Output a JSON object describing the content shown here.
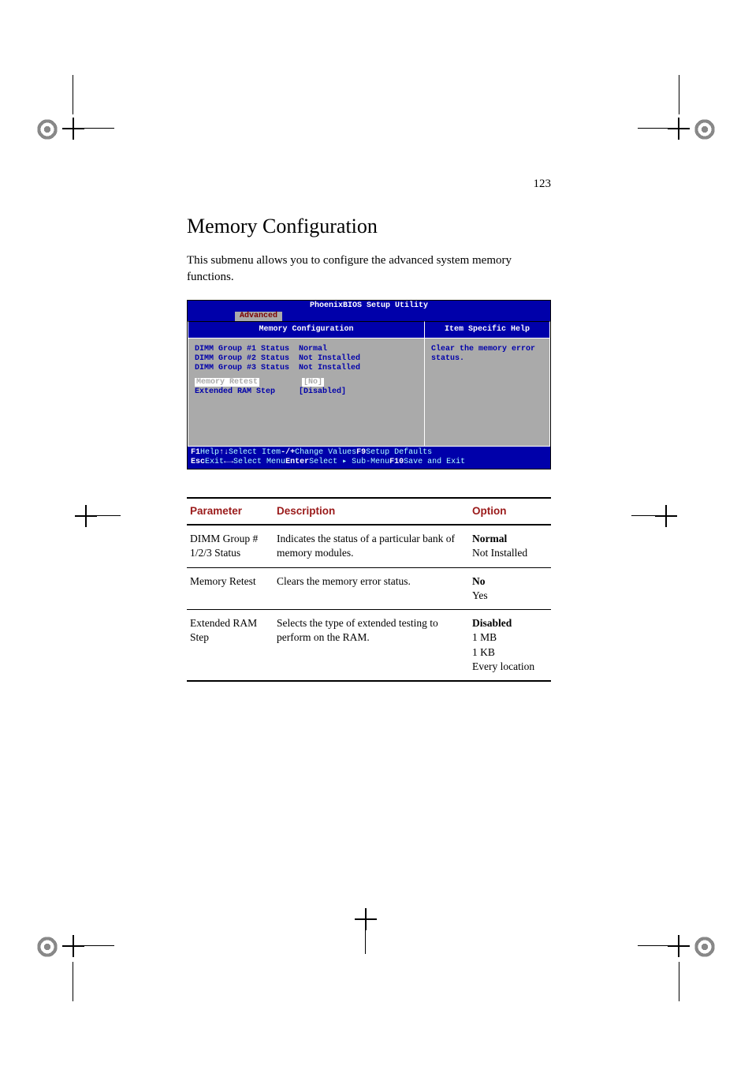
{
  "page_number": "123",
  "heading": "Memory Configuration",
  "intro": "This submenu allows you to configure the advanced system memory functions.",
  "bios": {
    "title": "PhoenixBIOS Setup Utility",
    "tab": "Advanced",
    "panel_heading": "Memory Configuration",
    "help_heading": "Item Specific Help",
    "help_body": "Clear the memory error status.",
    "rows": [
      {
        "label": "DIMM Group #1 Status",
        "value": "Normal"
      },
      {
        "label": "DIMM Group #2 Status",
        "value": "Not Installed"
      },
      {
        "label": "DIMM Group #3 Status",
        "value": "Not Installed"
      }
    ],
    "selected": {
      "label": "Memory Retest",
      "value": "[No]"
    },
    "extended": {
      "label": "Extended RAM Step",
      "value": "[Disabled]"
    },
    "footer": {
      "r1": {
        "k1": "F1",
        "d1": "Help",
        "k2": "↑↓",
        "d2": "Select Item",
        "k3": "-/+",
        "d3": "Change Values",
        "k4": "F9",
        "d4": "Setup Defaults"
      },
      "r2": {
        "k1": "Esc",
        "d1": "Exit",
        "k2": "←→",
        "d2": "Select Menu",
        "k3": "Enter",
        "d3": "Select ▸ Sub-Menu",
        "k4": "F10",
        "d4": "Save and Exit"
      }
    }
  },
  "table": {
    "headers": {
      "param": "Parameter",
      "desc": "Description",
      "opt": "Option"
    },
    "rows": [
      {
        "param": "DIMM Group # 1/2/3 Status",
        "desc": "Indicates the status of a particular bank of memory modules.",
        "opt_bold": "Normal",
        "opt_rest": [
          "Not Installed"
        ]
      },
      {
        "param": "Memory Retest",
        "desc": "Clears the memory error status.",
        "opt_bold": "No",
        "opt_rest": [
          "Yes"
        ]
      },
      {
        "param": "Extended RAM Step",
        "desc": "Selects the type of extended testing to perform on the RAM.",
        "opt_bold": "Disabled",
        "opt_rest": [
          "1 MB",
          "1 KB",
          "Every location"
        ]
      }
    ]
  }
}
